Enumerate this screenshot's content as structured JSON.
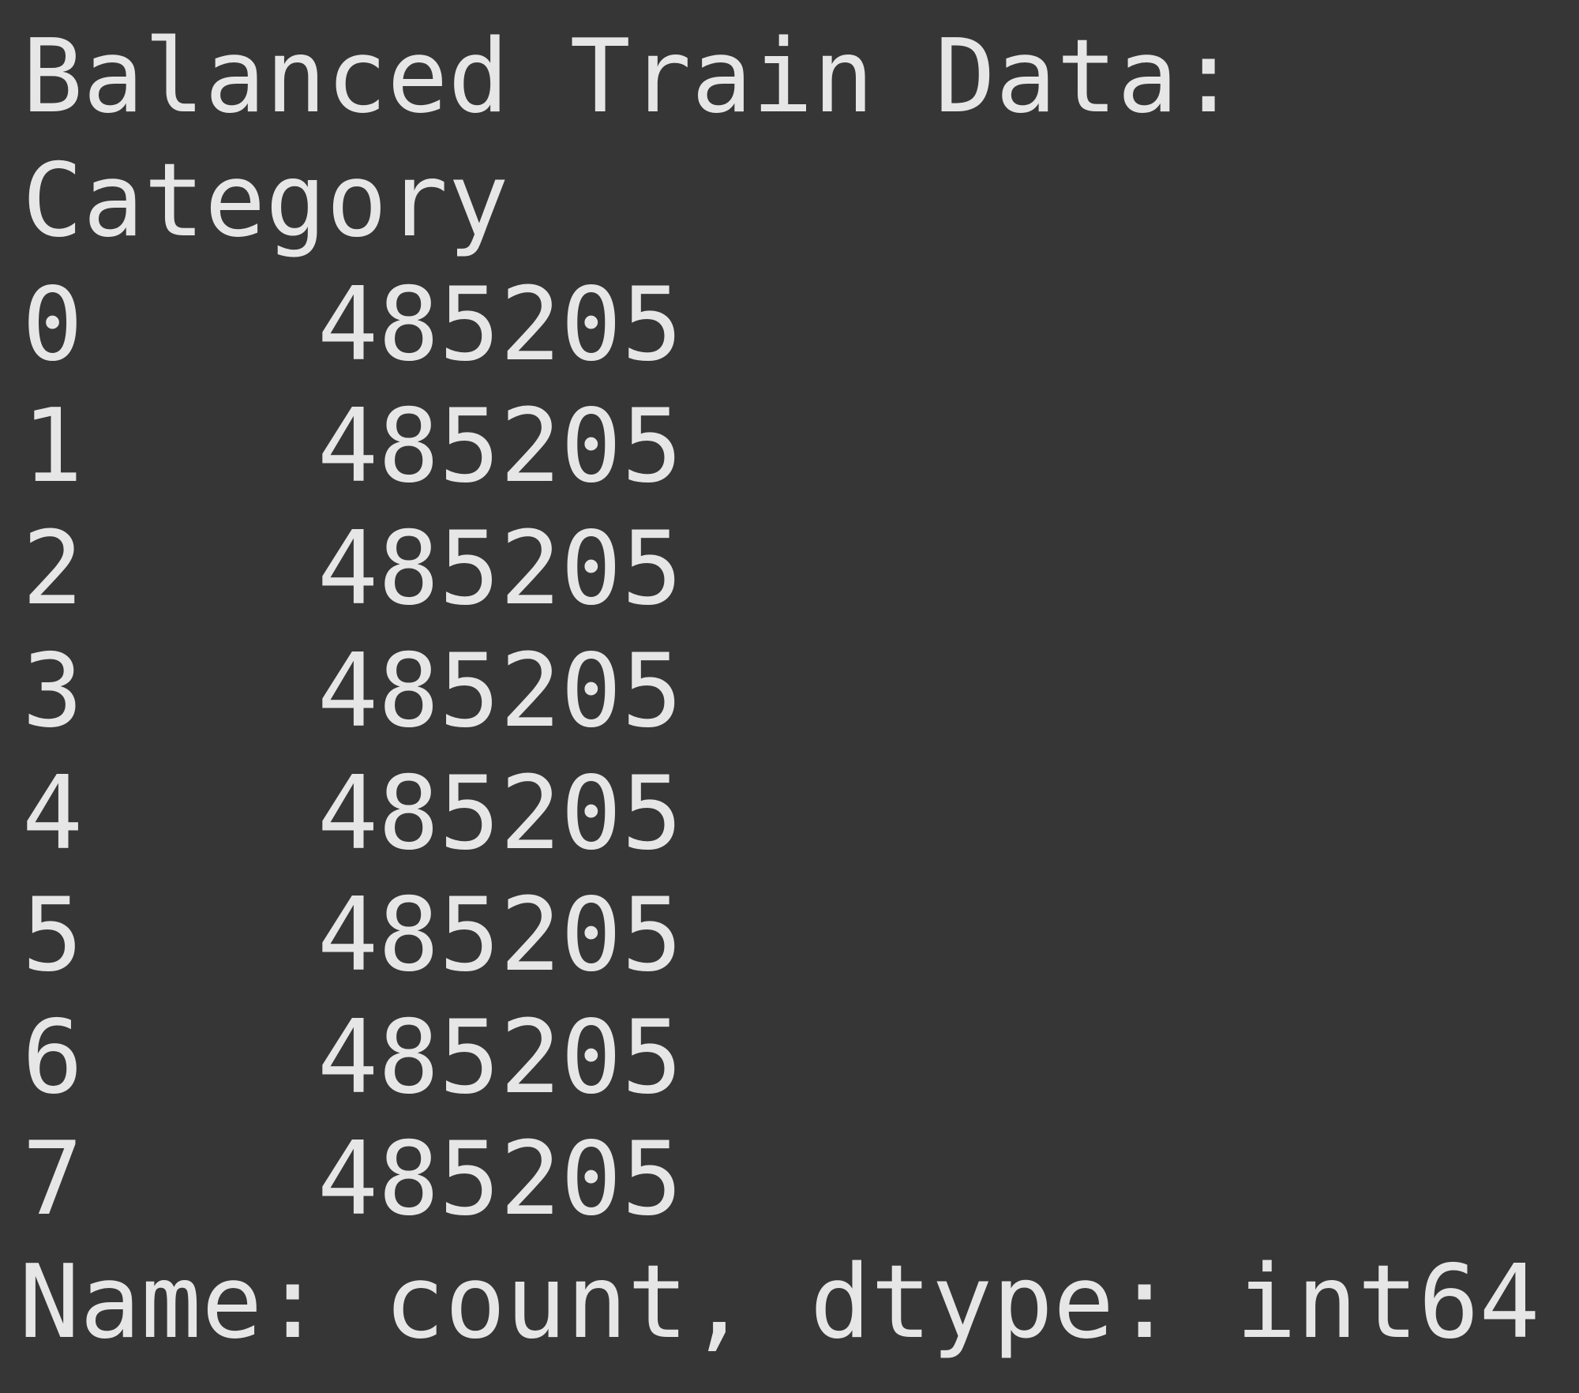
{
  "output": {
    "heading": "Balanced Train Data:",
    "index_name": "Category",
    "rows": [
      {
        "index": "0",
        "count": "485205"
      },
      {
        "index": "1",
        "count": "485205"
      },
      {
        "index": "2",
        "count": "485205"
      },
      {
        "index": "3",
        "count": "485205"
      },
      {
        "index": "4",
        "count": "485205"
      },
      {
        "index": "5",
        "count": "485205"
      },
      {
        "index": "6",
        "count": "485205"
      },
      {
        "index": "7",
        "count": "485205"
      }
    ],
    "footer": "Name: count, dtype: int64"
  },
  "colors": {
    "background": "#363636",
    "text": "#e6e6e6"
  }
}
